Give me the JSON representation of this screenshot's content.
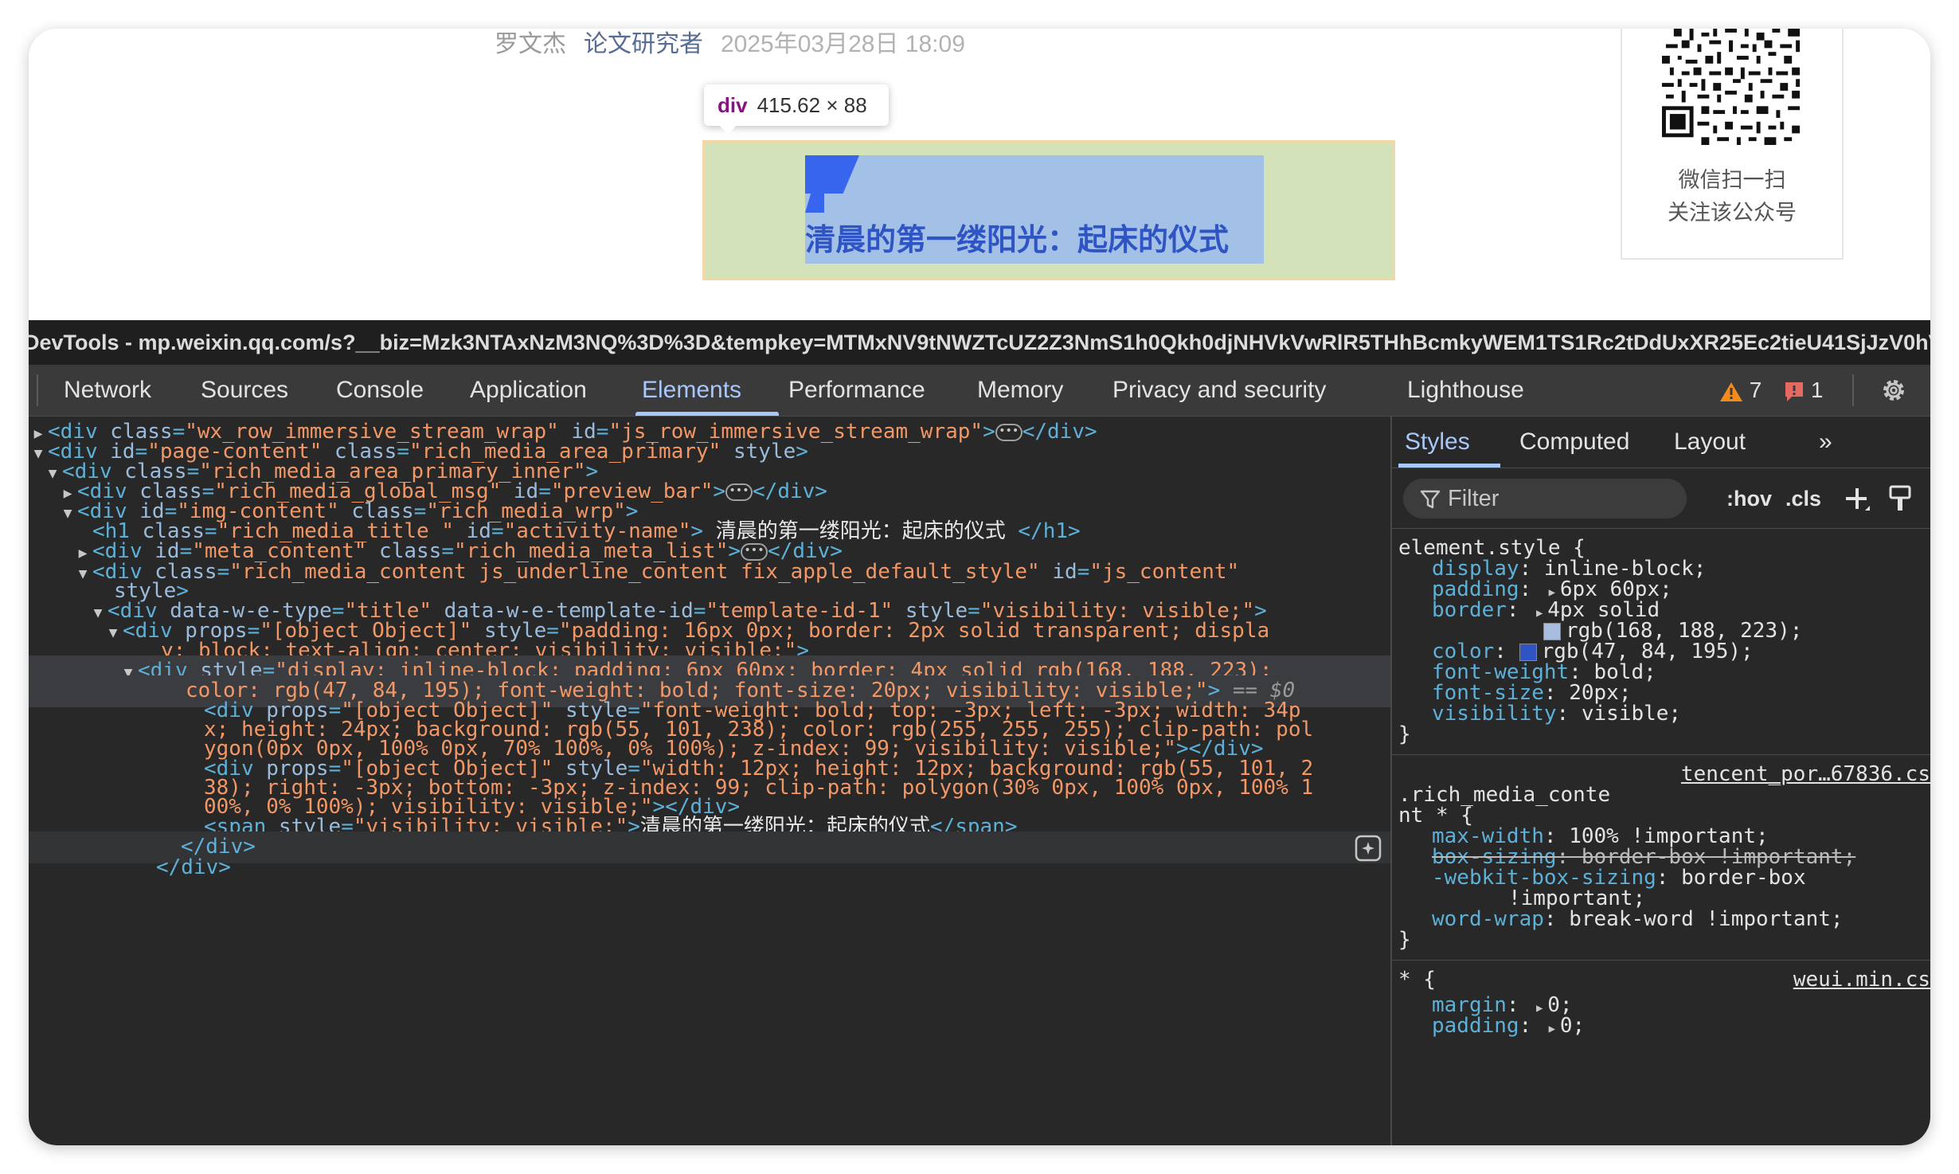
{
  "page": {
    "author": "罗文杰",
    "account": "论文研究者",
    "datetime": "2025年03月28日 18:09",
    "tooltip_tag": "div",
    "tooltip_dims": "415.62 × 88",
    "title_text": "清晨的第一缕阳光：起床的仪式",
    "qr_caption_1": "微信扫一扫",
    "qr_caption_2": "关注该公众号"
  },
  "devtools": {
    "window_title": "DevTools - mp.weixin.qq.com/s?__biz=Mzk3NTAxNzM3NQ%3D%3D&tempkey=MTMxNV9tNWZTcUZ2Z3NmS1h0Qkh0djNHVkVwRlR5THhBcmkyWEM1TS1Rc2tDdUxXR25Ec2tieU41SjJzV0hV",
    "tabs": [
      "Network",
      "Sources",
      "Console",
      "Application",
      "Elements",
      "Performance",
      "Memory",
      "Privacy and security",
      "Lighthouse"
    ],
    "active_tab": "Elements",
    "warnings_count": "7",
    "issues_count": "1",
    "colors": {
      "accent": "#a8c7fa",
      "tag": "#5db0d7",
      "attr": "#9bbbdc",
      "value": "#f29766",
      "bg": "#282828"
    }
  },
  "dom": {
    "l1_a": "\"wx_row_immersive_stream_wrap\"",
    "l1_b": "\"js_row_immersive_stream_wrap\"",
    "l2_a": "\"page-content\"",
    "l2_b": "\"rich_media_area_primary\"",
    "l3_a": "\"rich_media_area_primary_inner\"",
    "l4_a": "\"rich_media_global_msg\"",
    "l4_b": "\"preview_bar\"",
    "l5_a": "\"img-content\"",
    "l5_b": "\"rich_media_wrp\"",
    "l6_a": "\"rich_media_title \"",
    "l6_b": "\"activity-name\"",
    "l6_text": " 清晨的第一缕阳光：起床的仪式 ",
    "l7_a": "\"meta_content\"",
    "l7_b": "\"rich_media_meta_list\"",
    "l8_a": "\"rich_media_content js_underline_content fix_apple_default_style\"",
    "l8_b": "\"js_content\"",
    "l10_a": "\"title\"",
    "l10_b": "\"template-id-1\"",
    "l10_c": "\"visibility: visible;\"",
    "l11_a": "\"[object Object]\"",
    "l11_b": "\"padding: 16px 0px; border: 2px solid transparent; displa",
    "l12": "y: block; text-align: center; visibility: visible;\"",
    "l13": "\"display: inline-block; padding: 6px 60px; border: 4px solid rgb(168, 188, 223);",
    "l14": "color: rgb(47, 84, 195); font-weight: bold; font-size: 20px; visibility: visible;\"",
    "l14_eq": " == $0",
    "l15_a": "\"[object Object]\"",
    "l15_b": "\"font-weight: bold; top: -3px; left: -3px; width: 34p",
    "l16": "x; height: 24px; background: rgb(55, 101, 238); color: rgb(255, 255, 255); clip-path: pol",
    "l17": "ygon(0px 0px, 100% 0px, 70% 100%, 0% 100%); z-index: 99; visibility: visible;\"",
    "l18_a": "\"[object Object]\"",
    "l18_b": "\"width: 12px; height: 12px; background: rgb(55, 101, 2",
    "l19": "38); right: -3px; bottom: -3px; z-index: 99; clip-path: polygon(30% 0px, 100% 0px, 100% 1",
    "l20": "00%, 0% 100%); visibility: visible;\"",
    "l21_a": "\"visibility: visible;\"",
    "l21_text": "清晨的第一缕阳光：起床的仪式"
  },
  "styles": {
    "tabs": [
      "Styles",
      "Computed",
      "Layout"
    ],
    "filter_placeholder": "Filter",
    "hov": ":hov",
    "cls": ".cls",
    "element_style_selector": "element.style {",
    "element_props": [
      {
        "name": "display",
        "value": "inline-block;"
      },
      {
        "name": "padding",
        "value": "6px 60px;"
      },
      {
        "name": "border",
        "value": "4px solid"
      },
      {
        "name": "",
        "value": "rgb(168, 188, 223);"
      },
      {
        "name": "color",
        "value": "rgb(47, 84, 195);"
      },
      {
        "name": "font-weight",
        "value": "bold;"
      },
      {
        "name": "font-size",
        "value": "20px;"
      },
      {
        "name": "visibility",
        "value": "visible;"
      }
    ],
    "rule2_source": "tencent_por…67836.cs",
    "rule2_selector_1": ".rich_media_conte",
    "rule2_selector_2": "nt * {",
    "rule2_props": [
      {
        "name": "max-width",
        "value": "100% !important;"
      },
      {
        "name": "box-sizing",
        "value": "border-box !important;"
      },
      {
        "name": "-webkit-box-sizing",
        "value": "border-box"
      },
      {
        "name": "",
        "value": "!important;"
      },
      {
        "name": "word-wrap",
        "value": "break-word !important;"
      }
    ],
    "rule3_source": "weui.min.cs",
    "rule3_selector": "* {",
    "rule3_props": [
      {
        "name": "margin",
        "value": "0;"
      },
      {
        "name": "padding",
        "value": "0;"
      }
    ],
    "border_swatch": "#a8bcdf",
    "color_swatch": "#2f54c3"
  }
}
